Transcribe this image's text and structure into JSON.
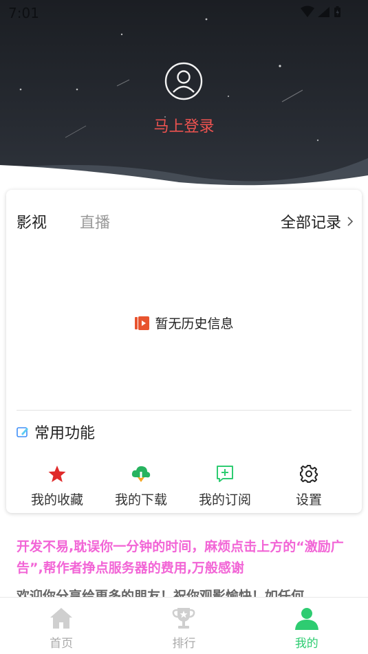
{
  "status_bar": {
    "time": "7:01"
  },
  "profile": {
    "login_label": "马上登录"
  },
  "history": {
    "tabs": [
      {
        "label": "影视",
        "active": true
      },
      {
        "label": "直播",
        "active": false
      }
    ],
    "all_records_label": "全部记录",
    "empty_text": "暂无历史信息"
  },
  "common": {
    "title": "常用功能",
    "items": [
      {
        "label": "我的收藏",
        "icon": "star-icon"
      },
      {
        "label": "我的下载",
        "icon": "cloud-download-icon"
      },
      {
        "label": "我的订阅",
        "icon": "subscribe-icon"
      },
      {
        "label": "设置",
        "icon": "gear-icon"
      }
    ]
  },
  "notice": {
    "text": "开发不易,耽误你一分钟的时间，麻烦点击上方的“激励广告”,帮作者挣点服务器的费用,万般感谢",
    "welcome": "欢迎你分享给更多的朋友！祝你观影愉快！如任何"
  },
  "bottom_nav": [
    {
      "label": "首页",
      "icon": "home-icon",
      "active": false
    },
    {
      "label": "排行",
      "icon": "trophy-icon",
      "active": false
    },
    {
      "label": "我的",
      "icon": "user-icon",
      "active": true
    }
  ],
  "colors": {
    "accent_green": "#2ecc71",
    "login_red": "#ef5350",
    "notice_pink": "#f265d6",
    "header_dark": "#1b1e23"
  }
}
